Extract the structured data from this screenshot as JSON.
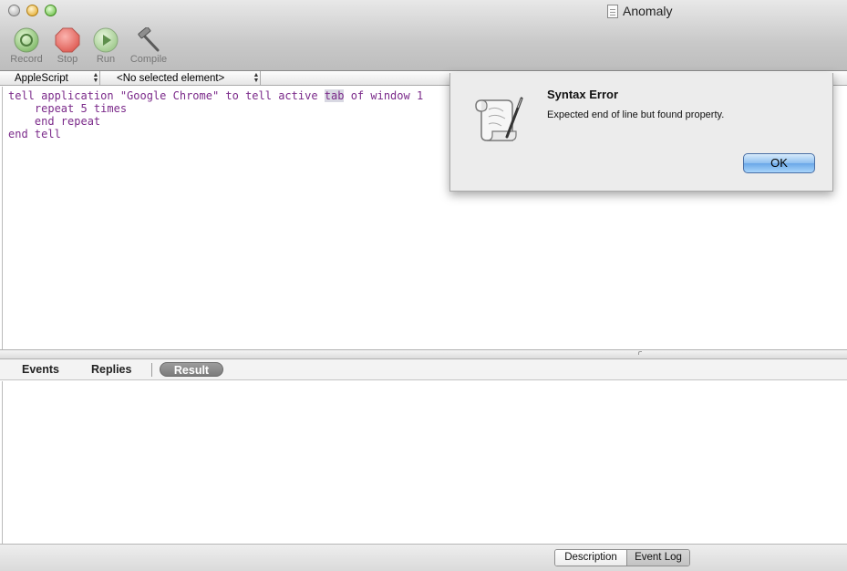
{
  "window": {
    "title": "Anomaly"
  },
  "toolbar": {
    "record_label": "Record",
    "stop_label": "Stop",
    "run_label": "Run",
    "compile_label": "Compile"
  },
  "navbar": {
    "language": "AppleScript",
    "element": "<No selected element>"
  },
  "editor": {
    "line1_a": "tell application \"Google Chrome\" to tell active ",
    "line1_highlight": "tab",
    "line1_b": " of window 1",
    "line2": "    repeat 5 times",
    "line3": "    end repeat",
    "line4": "end tell",
    "text_color": "#7b2a8a"
  },
  "tabs": {
    "events": "Events",
    "replies": "Replies",
    "result": "Result"
  },
  "bottom": {
    "description": "Description",
    "event_log": "Event Log"
  },
  "dialog": {
    "title": "Syntax Error",
    "message": "Expected end of line but found property.",
    "ok_label": "OK"
  }
}
